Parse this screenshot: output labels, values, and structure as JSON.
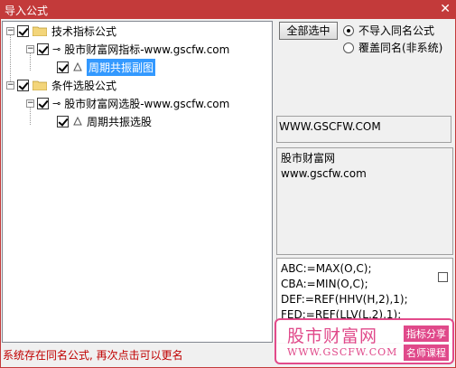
{
  "window": {
    "title": "导入公式",
    "close_glyph": "✕"
  },
  "tree": {
    "group1": {
      "label": "技术指标公式",
      "file": "股市财富网指标-www.gscfw.com",
      "formula": "周期共振副图"
    },
    "group2": {
      "label": "条件选股公式",
      "file": "股市财富网选股-www.gscfw.com",
      "formula": "周期共振选股"
    },
    "expander_glyph": "−"
  },
  "actions": {
    "select_all_label": "全部选中"
  },
  "options": {
    "no_import_label": "不导入同名公式",
    "overwrite_label": "覆盖同名(非系统)",
    "selected": "no_import"
  },
  "info": {
    "url": "WWW.GSCFW.COM",
    "desc_line1": "股市财富网",
    "desc_line2": "www.gscfw.com",
    "code_lines": [
      "ABC:=MAX(O,C);",
      "CBA:=MIN(O,C);",
      "DEF:=REF(HHV(H,2),1);",
      "FED:=REF(LLV(L,2),1);"
    ]
  },
  "status": {
    "message": "系统存在同名公式, 再次点击可以更名"
  },
  "watermark": {
    "brand": "股市财富网",
    "url": "WWW.GSCFW.COM",
    "tag1": "指标分享",
    "tag2": "名师课程"
  },
  "colors": {
    "titlebar": "#c33a3a",
    "selection": "#3399ff",
    "status_text": "#c00000",
    "watermark": "#e0498a"
  }
}
